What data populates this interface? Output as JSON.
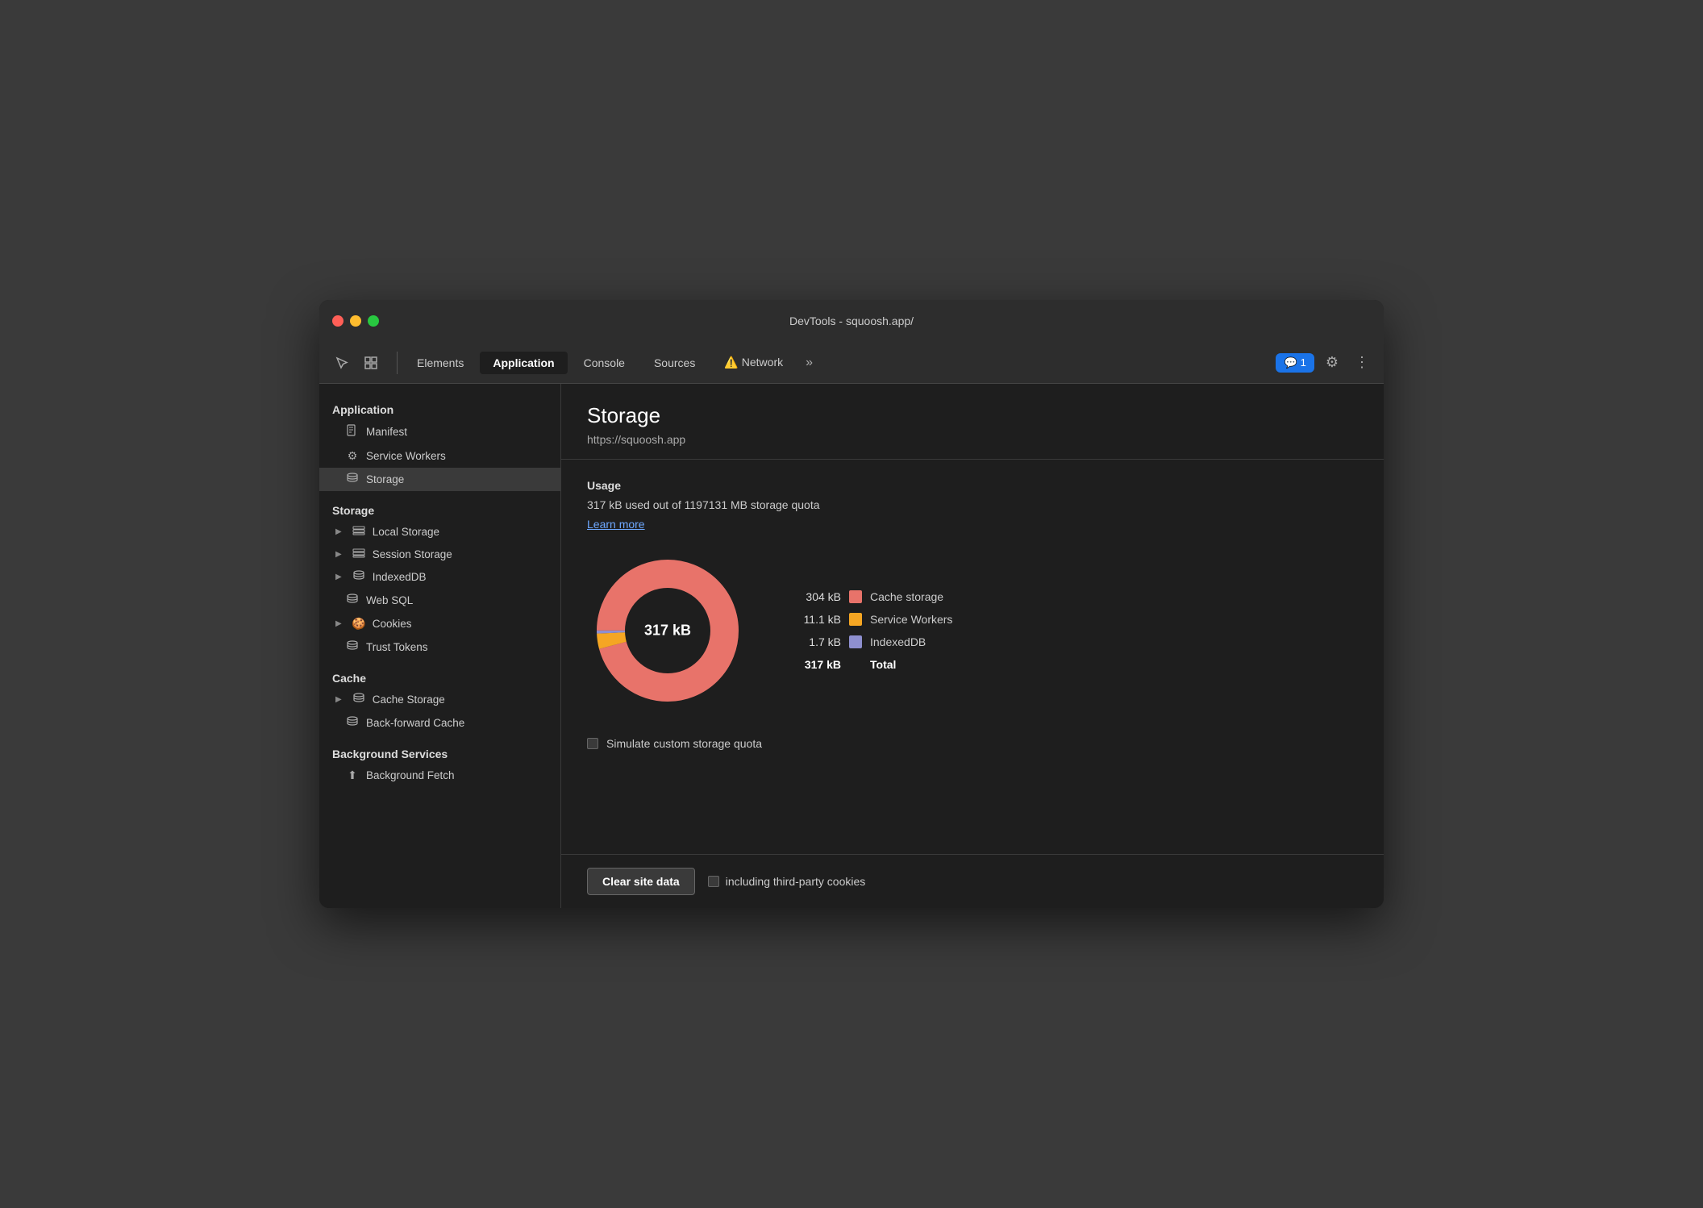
{
  "window": {
    "title": "DevTools - squoosh.app/"
  },
  "titlebar": {
    "title": "DevTools - squoosh.app/"
  },
  "tabbar": {
    "cursor_icon": "↖",
    "layers_icon": "⊡",
    "tabs": [
      {
        "label": "Elements",
        "active": false
      },
      {
        "label": "Application",
        "active": true
      },
      {
        "label": "Console",
        "active": false
      },
      {
        "label": "Sources",
        "active": false
      },
      {
        "label": "Network",
        "active": false,
        "warning": true
      }
    ],
    "more_label": "»",
    "notification_label": "1",
    "settings_icon": "⚙",
    "more_icon": "⋮"
  },
  "sidebar": {
    "sections": [
      {
        "label": "Application",
        "items": [
          {
            "label": "Manifest",
            "icon": "📄",
            "expand": false
          },
          {
            "label": "Service Workers",
            "icon": "⚙",
            "expand": false
          },
          {
            "label": "Storage",
            "icon": "🗄",
            "expand": false,
            "active": true
          }
        ]
      },
      {
        "label": "Storage",
        "items": [
          {
            "label": "Local Storage",
            "icon": "▦",
            "expand": true
          },
          {
            "label": "Session Storage",
            "icon": "▦",
            "expand": true
          },
          {
            "label": "IndexedDB",
            "icon": "🗄",
            "expand": true
          },
          {
            "label": "Web SQL",
            "icon": "🗄",
            "expand": false
          },
          {
            "label": "Cookies",
            "icon": "🍪",
            "expand": true
          },
          {
            "label": "Trust Tokens",
            "icon": "🗄",
            "expand": false
          }
        ]
      },
      {
        "label": "Cache",
        "items": [
          {
            "label": "Cache Storage",
            "icon": "🗄",
            "expand": true
          },
          {
            "label": "Back-forward Cache",
            "icon": "🗄",
            "expand": false
          }
        ]
      },
      {
        "label": "Background Services",
        "items": [
          {
            "label": "Background Fetch",
            "icon": "⬆",
            "expand": false
          }
        ]
      }
    ]
  },
  "panel": {
    "title": "Storage",
    "url": "https://squoosh.app",
    "usage_label": "Usage",
    "usage_text": "317 kB used out of 1197131 MB storage quota",
    "learn_more": "Learn more",
    "donut_center_label": "317 kB",
    "legend": [
      {
        "color": "#e8736a",
        "value": "304 kB",
        "name": "Cache storage"
      },
      {
        "color": "#f5a623",
        "value": "11.1 kB",
        "name": "Service Workers"
      },
      {
        "color": "#8e8fcf",
        "value": "1.7 kB",
        "name": "IndexedDB"
      },
      {
        "color": "",
        "value": "317 kB",
        "name": "Total",
        "total": true
      }
    ],
    "simulate_label": "Simulate custom storage quota",
    "chart": {
      "cache_pct": 0.96,
      "workers_pct": 0.035,
      "indexed_pct": 0.005,
      "cache_color": "#e8736a",
      "workers_color": "#f5a623",
      "indexed_color": "#8e8fcf"
    }
  },
  "footer": {
    "clear_btn": "Clear site data",
    "checkbox_label": "including third-party cookies"
  }
}
